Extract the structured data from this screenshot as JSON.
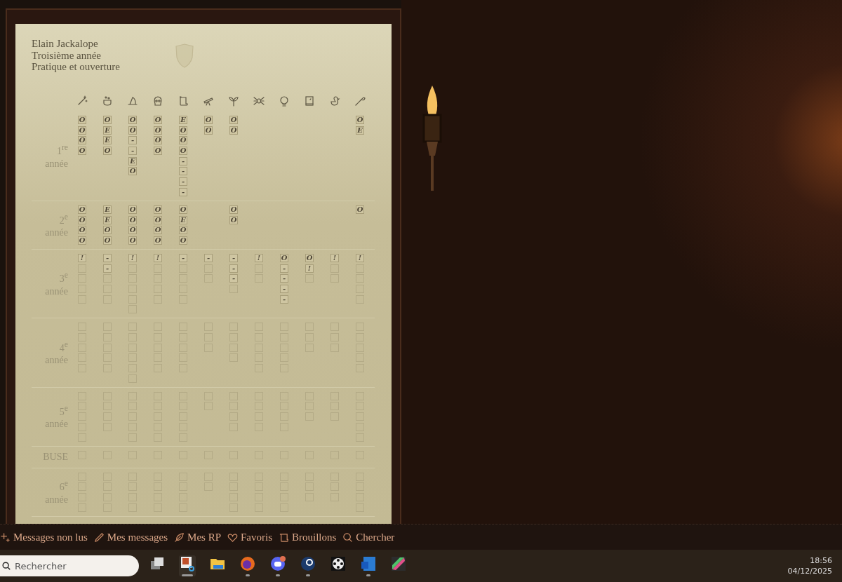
{
  "header": {
    "lines": [
      "Elain Jackalope",
      "Troisième année",
      "Pratique et ouverture"
    ]
  },
  "years": [
    {
      "label": "1$^{re}$ année",
      "columns": [
        [
          {
            "filled": true,
            "grade": "O"
          },
          {
            "filled": true,
            "grade": "O"
          },
          {
            "filled": true,
            "grade": "O"
          },
          {
            "filled": true,
            "grade": "O"
          }
        ],
        [
          {
            "filled": true,
            "grade": "O"
          },
          {
            "filled": true,
            "grade": "E"
          },
          {
            "filled": true,
            "grade": "E"
          },
          {
            "filled": true,
            "grade": "O"
          }
        ],
        [
          {
            "filled": true,
            "grade": "O"
          },
          {
            "filled": true,
            "grade": "O"
          },
          {
            "filled": true,
            "grade": "-"
          },
          {
            "filled": true,
            "grade": "-"
          },
          {
            "filled": true,
            "grade": "E"
          },
          {
            "filled": true,
            "grade": "O"
          }
        ],
        [
          {
            "filled": true,
            "grade": "O"
          },
          {
            "filled": true,
            "grade": "O"
          },
          {
            "filled": true,
            "grade": "O"
          },
          {
            "filled": true,
            "grade": "O"
          }
        ],
        [
          {
            "filled": true,
            "grade": "E"
          },
          {
            "filled": true,
            "grade": "O"
          },
          {
            "filled": true,
            "grade": "O"
          },
          {
            "filled": true,
            "grade": "O"
          },
          {
            "filled": true,
            "grade": "-"
          },
          {
            "filled": true,
            "grade": "-"
          },
          {
            "filled": true,
            "grade": "-"
          },
          {
            "filled": true,
            "grade": "-"
          }
        ],
        [
          {
            "filled": true,
            "grade": "O"
          },
          {
            "filled": true,
            "grade": "O"
          }
        ],
        [
          {
            "filled": true,
            "grade": "O"
          },
          {
            "filled": true,
            "grade": "O"
          }
        ],
        [],
        [],
        [],
        [],
        [
          {
            "filled": true,
            "grade": "O"
          },
          {
            "filled": true,
            "grade": "E"
          }
        ]
      ]
    },
    {
      "label": "2$^{e}$ année",
      "columns": [
        [
          {
            "filled": true,
            "grade": "O"
          },
          {
            "filled": true,
            "grade": "O"
          },
          {
            "filled": true,
            "grade": "O"
          },
          {
            "filled": true,
            "grade": "O"
          }
        ],
        [
          {
            "filled": true,
            "grade": "E"
          },
          {
            "filled": true,
            "grade": "E"
          },
          {
            "filled": true,
            "grade": "O"
          },
          {
            "filled": true,
            "grade": "O"
          }
        ],
        [
          {
            "filled": true,
            "grade": "O"
          },
          {
            "filled": true,
            "grade": "O"
          },
          {
            "filled": true,
            "grade": "O"
          },
          {
            "filled": true,
            "grade": "O"
          }
        ],
        [
          {
            "filled": true,
            "grade": "O"
          },
          {
            "filled": true,
            "grade": "O"
          },
          {
            "filled": true,
            "grade": "O"
          },
          {
            "filled": true,
            "grade": "O"
          }
        ],
        [
          {
            "filled": true,
            "grade": "O"
          },
          {
            "filled": true,
            "grade": "E"
          },
          {
            "filled": true,
            "grade": "O"
          },
          {
            "filled": true,
            "grade": "O"
          }
        ],
        [],
        [
          {
            "filled": true,
            "grade": "O"
          },
          {
            "filled": true,
            "grade": "O"
          }
        ],
        [],
        [],
        [],
        [],
        [
          {
            "filled": true,
            "grade": "O"
          }
        ]
      ]
    },
    {
      "label": "3$^{e}$ année",
      "columns": [
        [
          {
            "filled": true,
            "grade": "!"
          },
          {
            "filled": false
          },
          {
            "filled": false
          },
          {
            "filled": false
          },
          {
            "filled": false
          }
        ],
        [
          {
            "filled": true,
            "grade": "-"
          },
          {
            "filled": true,
            "grade": "-"
          },
          {
            "filled": false
          },
          {
            "filled": false
          },
          {
            "filled": false
          }
        ],
        [
          {
            "filled": true,
            "grade": "!"
          },
          {
            "filled": false
          },
          {
            "filled": false
          },
          {
            "filled": false
          },
          {
            "filled": false
          },
          {
            "filled": false
          }
        ],
        [
          {
            "filled": true,
            "grade": "!"
          },
          {
            "filled": false
          },
          {
            "filled": false
          },
          {
            "filled": false
          },
          {
            "filled": false
          }
        ],
        [
          {
            "filled": true,
            "grade": "-"
          },
          {
            "filled": false
          },
          {
            "filled": false
          },
          {
            "filled": false
          },
          {
            "filled": false
          }
        ],
        [
          {
            "filled": true,
            "grade": "-"
          },
          {
            "filled": false
          },
          {
            "filled": false
          }
        ],
        [
          {
            "filled": true,
            "grade": "-"
          },
          {
            "filled": true,
            "grade": "-"
          },
          {
            "filled": true,
            "grade": "-"
          },
          {
            "filled": false
          }
        ],
        [
          {
            "filled": true,
            "grade": "!"
          },
          {
            "filled": false
          },
          {
            "filled": false
          }
        ],
        [
          {
            "filled": true,
            "grade": "O"
          },
          {
            "filled": true,
            "grade": "-"
          },
          {
            "filled": true,
            "grade": "-"
          },
          {
            "filled": true,
            "grade": "-"
          },
          {
            "filled": true,
            "grade": "-"
          }
        ],
        [
          {
            "filled": true,
            "grade": "O"
          },
          {
            "filled": true,
            "grade": "!"
          },
          {
            "filled": false
          }
        ],
        [
          {
            "filled": true,
            "grade": "!"
          },
          {
            "filled": false
          },
          {
            "filled": false
          }
        ],
        [
          {
            "filled": true,
            "grade": "!"
          },
          {
            "filled": false
          },
          {
            "filled": false
          },
          {
            "filled": false
          },
          {
            "filled": false
          }
        ]
      ]
    },
    {
      "label": "4$^{e}$ année",
      "columns": [
        [
          {
            "filled": false
          },
          {
            "filled": false
          },
          {
            "filled": false
          },
          {
            "filled": false
          },
          {
            "filled": false
          }
        ],
        [
          {
            "filled": false
          },
          {
            "filled": false
          },
          {
            "filled": false
          },
          {
            "filled": false
          },
          {
            "filled": false
          }
        ],
        [
          {
            "filled": false
          },
          {
            "filled": false
          },
          {
            "filled": false
          },
          {
            "filled": false
          },
          {
            "filled": false
          },
          {
            "filled": false
          }
        ],
        [
          {
            "filled": false
          },
          {
            "filled": false
          },
          {
            "filled": false
          },
          {
            "filled": false
          },
          {
            "filled": false
          }
        ],
        [
          {
            "filled": false
          },
          {
            "filled": false
          },
          {
            "filled": false
          },
          {
            "filled": false
          },
          {
            "filled": false
          }
        ],
        [
          {
            "filled": false
          },
          {
            "filled": false
          },
          {
            "filled": false
          }
        ],
        [
          {
            "filled": false
          },
          {
            "filled": false
          },
          {
            "filled": false
          },
          {
            "filled": false
          }
        ],
        [
          {
            "filled": false
          },
          {
            "filled": false
          },
          {
            "filled": false
          },
          {
            "filled": false
          },
          {
            "filled": false
          }
        ],
        [
          {
            "filled": false
          },
          {
            "filled": false
          },
          {
            "filled": false
          },
          {
            "filled": false
          },
          {
            "filled": false
          }
        ],
        [
          {
            "filled": false
          },
          {
            "filled": false
          },
          {
            "filled": false
          }
        ],
        [
          {
            "filled": false
          },
          {
            "filled": false
          },
          {
            "filled": false
          }
        ],
        [
          {
            "filled": false
          },
          {
            "filled": false
          },
          {
            "filled": false
          },
          {
            "filled": false
          },
          {
            "filled": false
          }
        ]
      ]
    },
    {
      "label": "5$^{e}$ année",
      "columns": [
        [
          {
            "filled": false
          },
          {
            "filled": false
          },
          {
            "filled": false
          },
          {
            "filled": false
          },
          {
            "filled": false
          }
        ],
        [
          {
            "filled": false
          },
          {
            "filled": false
          },
          {
            "filled": false
          },
          {
            "filled": false
          }
        ],
        [
          {
            "filled": false
          },
          {
            "filled": false
          },
          {
            "filled": false
          },
          {
            "filled": false
          },
          {
            "filled": false
          }
        ],
        [
          {
            "filled": false
          },
          {
            "filled": false
          },
          {
            "filled": false
          },
          {
            "filled": false
          },
          {
            "filled": false
          }
        ],
        [
          {
            "filled": false
          },
          {
            "filled": false
          },
          {
            "filled": false
          },
          {
            "filled": false
          },
          {
            "filled": false
          }
        ],
        [
          {
            "filled": false
          },
          {
            "filled": false
          }
        ],
        [
          {
            "filled": false
          },
          {
            "filled": false
          },
          {
            "filled": false
          },
          {
            "filled": false
          }
        ],
        [
          {
            "filled": false
          },
          {
            "filled": false
          },
          {
            "filled": false
          },
          {
            "filled": false
          }
        ],
        [
          {
            "filled": false
          },
          {
            "filled": false
          },
          {
            "filled": false
          },
          {
            "filled": false
          }
        ],
        [
          {
            "filled": false
          },
          {
            "filled": false
          },
          {
            "filled": false
          }
        ],
        [
          {
            "filled": false
          },
          {
            "filled": false
          },
          {
            "filled": false
          }
        ],
        [
          {
            "filled": false
          },
          {
            "filled": false
          },
          {
            "filled": false
          },
          {
            "filled": false
          },
          {
            "filled": false
          }
        ]
      ]
    },
    {
      "label": "BUSE",
      "columns": [
        [
          {
            "filled": false
          }
        ],
        [
          {
            "filled": false
          }
        ],
        [
          {
            "filled": false
          }
        ],
        [
          {
            "filled": false
          }
        ],
        [
          {
            "filled": false
          }
        ],
        [
          {
            "filled": false
          }
        ],
        [
          {
            "filled": false
          }
        ],
        [
          {
            "filled": false
          }
        ],
        [
          {
            "filled": false
          }
        ],
        [
          {
            "filled": false
          }
        ],
        [
          {
            "filled": false
          }
        ],
        [
          {
            "filled": false
          }
        ]
      ]
    },
    {
      "label": "6$^{e}$ année",
      "columns": [
        [
          {
            "filled": false
          },
          {
            "filled": false
          },
          {
            "filled": false
          },
          {
            "filled": false
          }
        ],
        [
          {
            "filled": false
          },
          {
            "filled": false
          },
          {
            "filled": false
          },
          {
            "filled": false
          }
        ],
        [
          {
            "filled": false
          },
          {
            "filled": false
          },
          {
            "filled": false
          },
          {
            "filled": false
          }
        ],
        [
          {
            "filled": false
          },
          {
            "filled": false
          },
          {
            "filled": false
          },
          {
            "filled": false
          }
        ],
        [
          {
            "filled": false
          },
          {
            "filled": false
          },
          {
            "filled": false
          },
          {
            "filled": false
          }
        ],
        [
          {
            "filled": false
          },
          {
            "filled": false
          }
        ],
        [
          {
            "filled": false
          },
          {
            "filled": false
          },
          {
            "filled": false
          },
          {
            "filled": false
          }
        ],
        [
          {
            "filled": false
          },
          {
            "filled": false
          },
          {
            "filled": false
          },
          {
            "filled": false
          }
        ],
        [
          {
            "filled": false
          },
          {
            "filled": false
          },
          {
            "filled": false
          },
          {
            "filled": false
          }
        ],
        [
          {
            "filled": false
          },
          {
            "filled": false
          },
          {
            "filled": false
          }
        ],
        [
          {
            "filled": false
          },
          {
            "filled": false
          },
          {
            "filled": false
          }
        ],
        [
          {
            "filled": false
          },
          {
            "filled": false
          },
          {
            "filled": false
          },
          {
            "filled": false
          }
        ]
      ]
    }
  ],
  "nav_links": [
    "Messages non lus",
    "Mes messages",
    "Mes RP",
    "Favoris",
    "Brouillons",
    "Chercher"
  ],
  "taskbar": {
    "search": {
      "placeholder": "Rechercher"
    },
    "apps": [
      {
        "running": false,
        "active": false
      },
      {
        "running": true,
        "active": true
      },
      {
        "running": false,
        "active": false
      },
      {
        "running": true,
        "active": false
      },
      {
        "running": true,
        "active": false
      },
      {
        "running": true,
        "active": false
      },
      {
        "running": false,
        "active": false
      },
      {
        "running": true,
        "active": false
      },
      {
        "running": false,
        "active": false
      }
    ],
    "time": "18:56",
    "date": "04/12/2025"
  }
}
